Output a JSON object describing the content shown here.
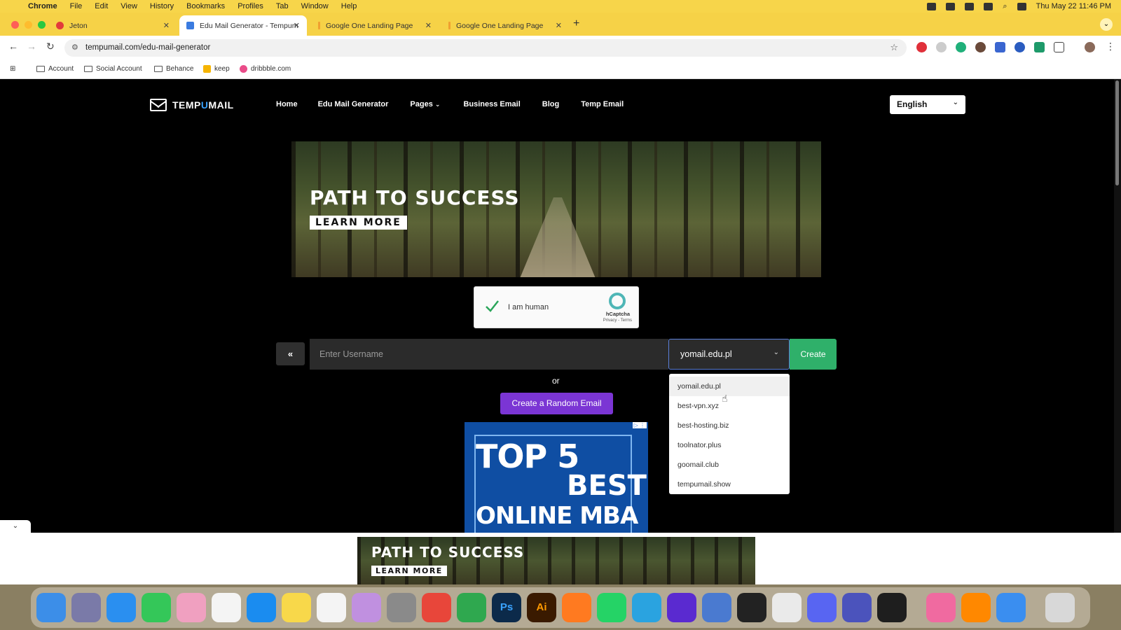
{
  "menubar": {
    "app_name": "Chrome",
    "items": [
      "File",
      "Edit",
      "View",
      "History",
      "Bookmarks",
      "Profiles",
      "Tab",
      "Window",
      "Help"
    ],
    "clock": "Thu May 22  11:46 PM"
  },
  "tabs": [
    {
      "title": "Jeton",
      "favicon_color": "#e23b3b"
    },
    {
      "title": "Edu Mail Generator - Tempum",
      "favicon_color": "#3a7be0"
    },
    {
      "title": "Google One Landing Page",
      "favicon_color": "#f0a030"
    },
    {
      "title": "Google One Landing Page",
      "favicon_color": "#f0a030"
    }
  ],
  "toolbar": {
    "url": "tempumail.com/edu-mail-generator"
  },
  "bookmarks": [
    {
      "label": "Account",
      "icon": "folder-icon"
    },
    {
      "label": "Social Account",
      "icon": "folder-icon"
    },
    {
      "label": "Behance",
      "icon": "folder-icon"
    },
    {
      "label": "keep",
      "icon": "keep-icon"
    },
    {
      "label": "dribbble.com",
      "icon": "dribbble-icon"
    }
  ],
  "site": {
    "logo_a": "TEMP",
    "logo_u": "U",
    "logo_b": "MAIL",
    "nav": [
      "Home",
      "Edu Mail Generator",
      "Pages",
      "Business Email",
      "Blog",
      "Temp Email"
    ],
    "language": "English"
  },
  "banner": {
    "headline": "PATH TO SUCCESS",
    "cta": "LEARN MORE"
  },
  "captcha": {
    "label": "I am human",
    "brand": "hCaptcha",
    "links": "Privacy - Terms"
  },
  "form": {
    "back_label": "«",
    "username_placeholder": "Enter Username",
    "selected_domain": "yomail.edu.pl",
    "create_label": "Create",
    "or_text": "or",
    "random_label": "Create a Random Email"
  },
  "domain_options": [
    "yomail.edu.pl",
    "best-vpn.xyz",
    "best-hosting.biz",
    "toolnator.plus",
    "goomail.club",
    "tempumail.show"
  ],
  "ad_mba": {
    "line1": "TOP 5",
    "line2": "BEST",
    "line3": "ONLINE MBA"
  },
  "anchor_ad": {
    "headline": "PATH TO SUCCESS",
    "cta": "LEARN MORE"
  },
  "colors": {
    "chrome_accent": "#f6d247",
    "create_green": "#2fb06a",
    "random_purple": "#7b35d4",
    "logo_blue": "#3aa3ff"
  }
}
